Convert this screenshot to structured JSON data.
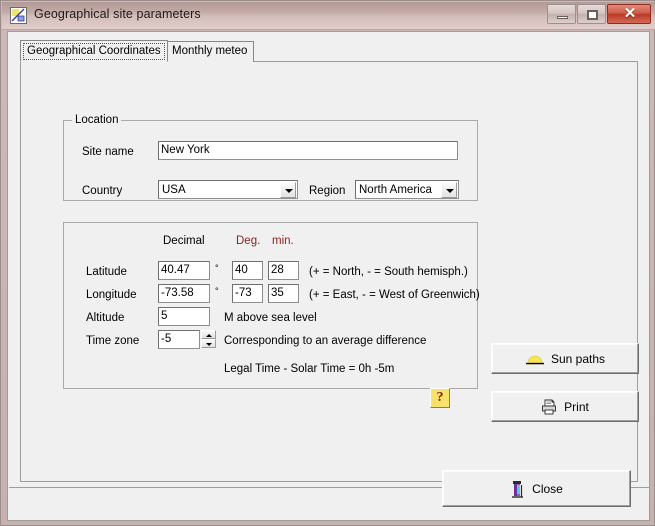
{
  "window": {
    "title": "Geographical site parameters",
    "app_icon": "chart-site-icon",
    "controls": {
      "minimize": "minimize-icon",
      "maximize": "maximize-icon",
      "close": "✕"
    }
  },
  "tabs": [
    {
      "label": "Geographical Coordinates",
      "active": true
    },
    {
      "label": "Monthly meteo",
      "active": false
    }
  ],
  "location": {
    "group_title": "Location",
    "site_name_label": "Site name",
    "site_name_value": "New York",
    "country_label": "Country",
    "country_value": "USA",
    "region_label": "Region",
    "region_value": "North America"
  },
  "coordinates": {
    "header_decimal": "Decimal",
    "header_deg": "Deg.",
    "header_min": "min.",
    "degree_symbol": "°",
    "latitude": {
      "label": "Latitude",
      "decimal": "40.47",
      "deg": "40",
      "min": "28",
      "hint": "(+ = North,  - = South hemisph.)"
    },
    "longitude": {
      "label": "Longitude",
      "decimal": "-73.58",
      "deg": "-73",
      "min": "35",
      "hint": "(+ = East, - = West of Greenwich)"
    },
    "altitude": {
      "label": "Altitude",
      "value": "5",
      "unit": "M above sea level"
    },
    "timezone": {
      "label": "Time zone",
      "value": "-5",
      "note": "Corresponding to an average difference",
      "legal_time": "Legal Time - Solar Time =   0h -5m"
    },
    "help_label": "?"
  },
  "buttons": {
    "sun_paths": {
      "label": "Sun paths",
      "icon": "sun-icon"
    },
    "print": {
      "label": "Print",
      "icon": "printer-icon"
    },
    "close": {
      "label": "Close",
      "icon": "exit-door-icon"
    }
  },
  "colors": {
    "accent_red": "#8c1f18",
    "help_yellow": "#f5e16b",
    "titlebar": "#c3aba7",
    "close_button": "#b93a26",
    "dialog_bg": "#f0f0f0"
  }
}
